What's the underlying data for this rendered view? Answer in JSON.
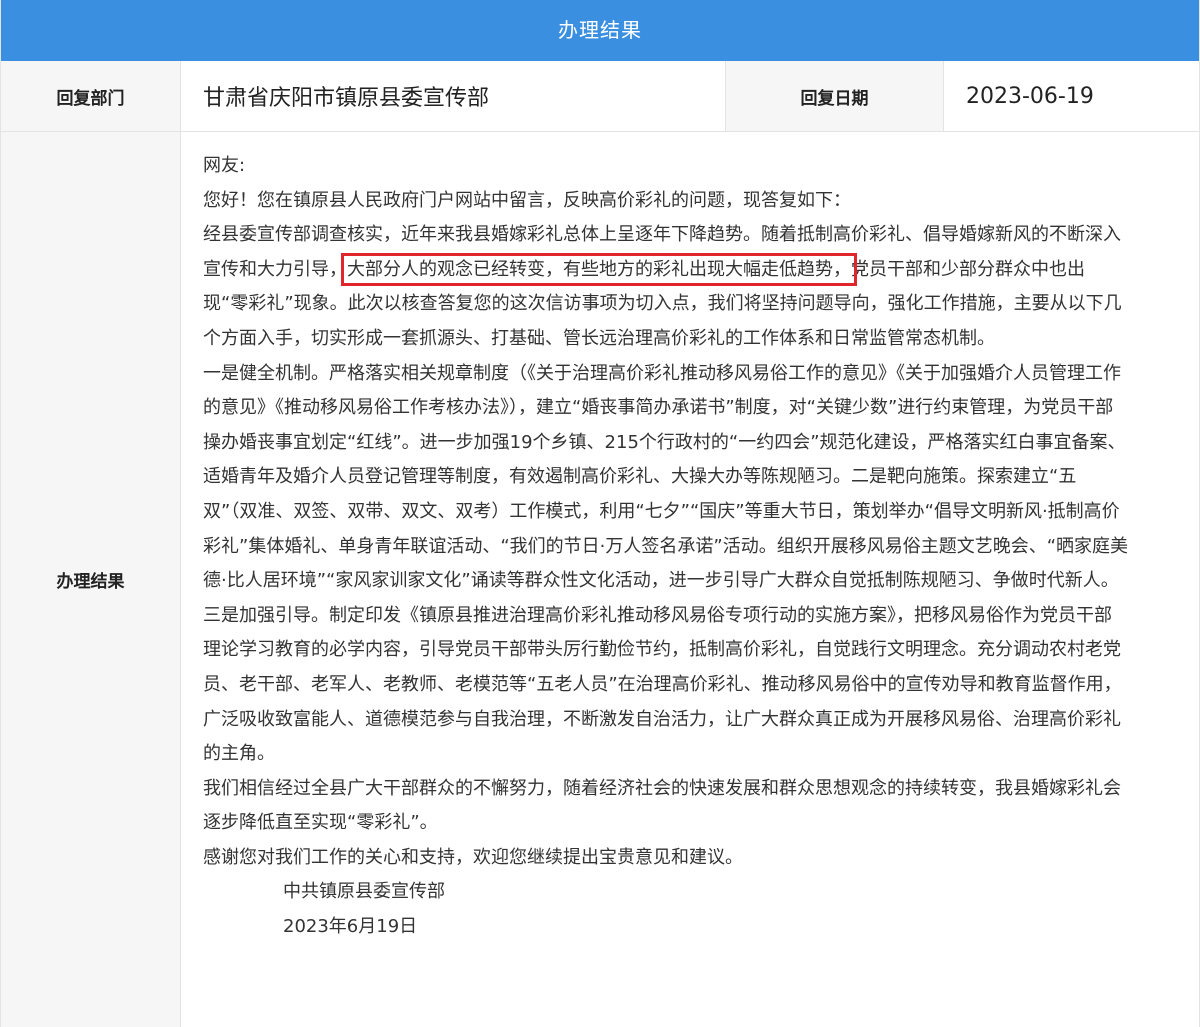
{
  "header": {
    "title": "办理结果"
  },
  "info_row": {
    "dept_label": "回复部门",
    "dept_value": "甘肃省庆阳市镇原县委宣传部",
    "date_label": "回复日期",
    "date_value": "2023-06-19"
  },
  "result": {
    "label": "办理结果",
    "greeting": "网友:",
    "intro": "您好！您在镇原县人民政府门户网站中留言，反映高价彩礼的问题，现答复如下：",
    "p1_before": "经县委宣传部调查核实，近年来我县婚嫁彩礼总体上呈逐年下降趋势。随着抵制高价彩礼、倡导婚嫁新风的不断深入宣传和大力引导，",
    "p1_highlight": "大部分人的观念已经转变，有些地方的彩礼出现大幅走低趋势，",
    "p1_after": "党员干部和少部分群众中也出现“零彩礼”现象。此次以核查答复您的这次信访事项为切入点，我们将坚持问题导向，强化工作措施，主要从以下几个方面入手，切实形成一套抓源头、打基础、管长远治理高价彩礼的工作体系和日常监管常态机制。",
    "p2": "一是健全机制。严格落实相关规章制度（《关于治理高价彩礼推动移风易俗工作的意见》《关于加强婚介人员管理工作的意见》《推动移风易俗工作考核办法》），建立“婚丧事简办承诺书”制度，对“关键少数”进行约束管理，为党员干部操办婚丧事宜划定“红线”。进一步加强19个乡镇、215个行政村的“一约四会”规范化建设，严格落实红白事宜备案、适婚青年及婚介人员登记管理等制度，有效遏制高价彩礼、大操大办等陈规陋习。二是靶向施策。探索建立“五双”（双准、双签、双带、双文、双考）工作模式，利用“七夕”“国庆”等重大节日，策划举办“倡导文明新风·抵制高价彩礼”集体婚礼、单身青年联谊活动、“我们的节日·万人签名承诺”活动。组织开展移风易俗主题文艺晚会、“晒家庭美德·比人居环境”“家风家训家文化”诵读等群众性文化活动，进一步引导广大群众自觉抵制陈规陋习、争做时代新人。三是加强引导。制定印发《镇原县推进治理高价彩礼推动移风易俗专项行动的实施方案》，把移风易俗作为党员干部理论学习教育的必学内容，引导党员干部带头厉行勤俭节约，抵制高价彩礼，自觉践行文明理念。充分调动农村老党员、老干部、老军人、老教师、老模范等“五老人员”在治理高价彩礼、推动移风易俗中的宣传劝导和教育监督作用，广泛吸收致富能人、道德模范参与自我治理，不断激发自治活力，让广大群众真正成为开展移风易俗、治理高价彩礼的主角。",
    "p3": "我们相信经过全县广大干部群众的不懈努力，随着经济社会的快速发展和群众思想观念的持续转变，我县婚嫁彩礼会逐步降低直至实现“零彩礼”。",
    "p4": "感谢您对我们工作的关心和支持，欢迎您继续提出宝贵意见和建议。",
    "signature": "中共镇原县委宣传部",
    "sign_date": "2023年6月19日"
  },
  "colors": {
    "header_bg": "#3a8fe0",
    "label_bg": "#f6f6f6",
    "highlight_box": "#e0262b"
  }
}
